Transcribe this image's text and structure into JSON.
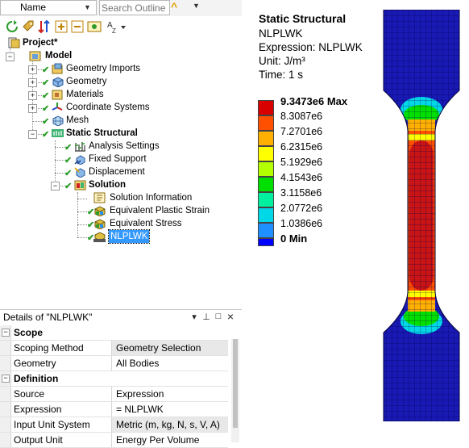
{
  "toolbar": {
    "name_dropdown": "Name",
    "search_placeholder": "Search Outline"
  },
  "tree": {
    "project": "Project*",
    "model": "Model",
    "geometry_imports": "Geometry Imports",
    "geometry": "Geometry",
    "materials": "Materials",
    "coordinate_systems": "Coordinate Systems",
    "mesh": "Mesh",
    "static_structural": "Static Structural",
    "analysis_settings": "Analysis Settings",
    "fixed_support": "Fixed Support",
    "displacement": "Displacement",
    "solution": "Solution",
    "solution_information": "Solution Information",
    "equivalent_plastic_strain": "Equivalent Plastic Strain",
    "equivalent_stress": "Equivalent Stress",
    "nlplwk": "NLPLWK"
  },
  "details": {
    "title": "Details of \"NLPLWK\"",
    "pin": "−□",
    "close": "×",
    "scope_header": "Scope",
    "rows_scope": [
      {
        "label": "Scoping Method",
        "value": "Geometry Selection"
      },
      {
        "label": "Geometry",
        "value": "All Bodies"
      }
    ],
    "definition_header": "Definition",
    "rows_definition": [
      {
        "label": "Source",
        "value": "Expression"
      },
      {
        "label": "Expression",
        "value": "= NLPLWK"
      },
      {
        "label": "Input Unit System",
        "value": "Metric (m, kg, N, s, V, A)"
      },
      {
        "label": "Output Unit",
        "value": "Energy Per Volume"
      }
    ]
  },
  "viewport": {
    "title": "Static Structural",
    "result_name": "NLPLWK",
    "expression": "Expression: NLPLWK",
    "unit": "Unit: J/m³",
    "time": "Time: 1 s",
    "legend": [
      {
        "label": "9.3473e6 Max",
        "color": "#d90000"
      },
      {
        "label": "8.3087e6",
        "color": "#ff5000"
      },
      {
        "label": "7.2701e6",
        "color": "#ffb000"
      },
      {
        "label": "6.2315e6",
        "color": "#ffff00"
      },
      {
        "label": "5.1929e6",
        "color": "#b4ff00"
      },
      {
        "label": "4.1543e6",
        "color": "#00e000"
      },
      {
        "label": "3.1158e6",
        "color": "#00f0a0"
      },
      {
        "label": "2.0772e6",
        "color": "#00d8e8"
      },
      {
        "label": "1.0386e6",
        "color": "#1e90ff"
      },
      {
        "label": "0 Min",
        "color": "#0000ff"
      }
    ]
  },
  "colors": {
    "selection": "#3399ff",
    "check": "#2a9d2a",
    "model_low": "#1919b4",
    "model_high": "#c81414"
  }
}
